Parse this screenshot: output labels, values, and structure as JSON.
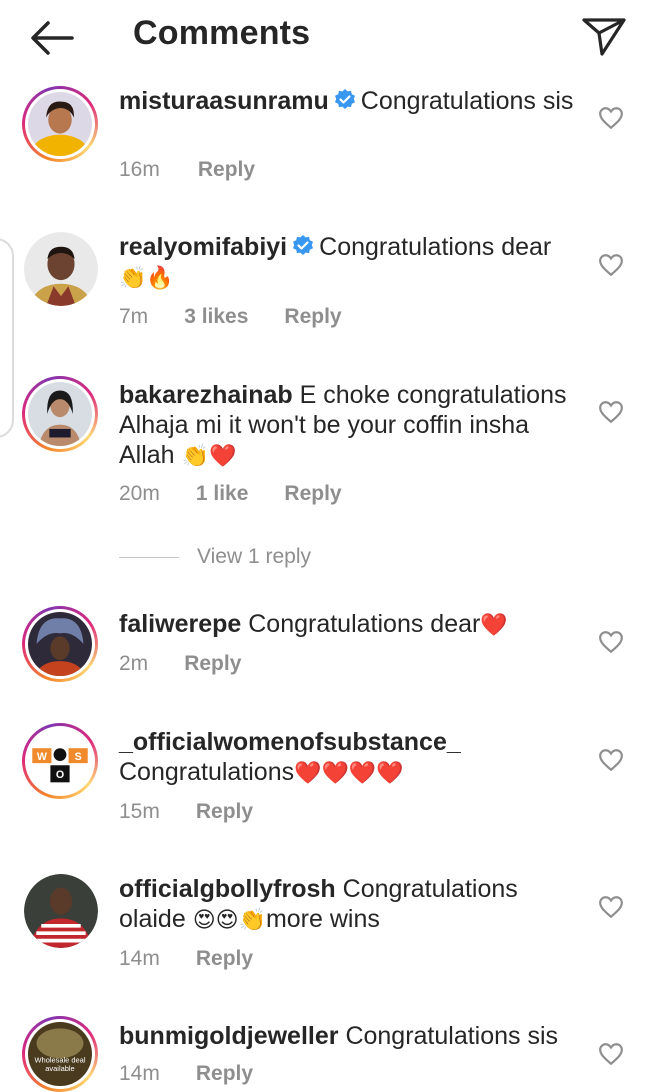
{
  "header": {
    "title": "Comments",
    "back_icon": "arrow-left-icon",
    "share_icon": "paper-plane-icon"
  },
  "colors": {
    "verified": "#3897f0",
    "heart_red": "#e0141e",
    "muted": "#8e8e8e"
  },
  "comments": [
    {
      "username": "misturaasunramu",
      "verified": true,
      "text": "Congratulations sis",
      "time": "16m",
      "likes": "",
      "reply": "Reply"
    },
    {
      "username": "realyomifabiyi",
      "verified": true,
      "text": "Congratulations dear",
      "emojis": "👏🔥",
      "time": "7m",
      "likes": "3 likes",
      "reply": "Reply"
    },
    {
      "username": "bakarezhainab",
      "verified": false,
      "text": "E choke congratulations Alhaja mi it won't be your coffin insha Allah",
      "emojis": "👏❤️",
      "time": "20m",
      "likes": "1 like",
      "reply": "Reply"
    },
    {
      "username": "faliwerepe",
      "verified": false,
      "text": "Congratulations dear",
      "emojis": "❤️",
      "time": "2m",
      "likes": "",
      "reply": "Reply"
    },
    {
      "username": "_officialwomenofsubstance_",
      "verified": false,
      "text": "Congratulations",
      "emojis": "❤️❤️❤️❤️",
      "time": "15m",
      "likes": "",
      "reply": "Reply"
    },
    {
      "username": "officialgbollyfrosh",
      "verified": false,
      "text": "Congratulations olaide",
      "emojis": "😍😍👏",
      "text_after": "more wins",
      "time": "14m",
      "likes": "",
      "reply": "Reply"
    },
    {
      "username": "bunmigoldjeweller",
      "verified": false,
      "text": "Congratulations sis",
      "time": "14m",
      "likes": "",
      "reply": "Reply"
    }
  ],
  "view_replies": "View 1 reply",
  "avatar_labels": {
    "wos_w": "W",
    "wos_s": "S",
    "wos_o": "O",
    "bunmi_line1": "Wholesale deal",
    "bunmi_line2": "available"
  }
}
